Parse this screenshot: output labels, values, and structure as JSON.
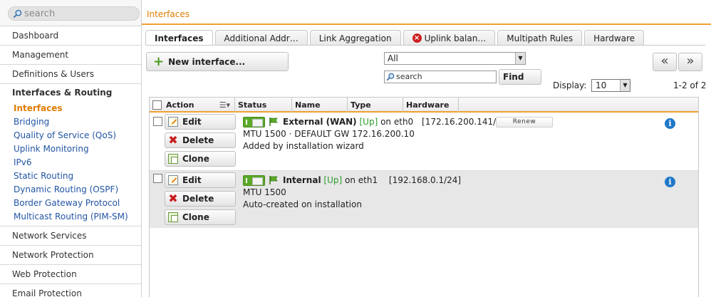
{
  "sidebar": {
    "search_placeholder": "search",
    "categories_top": [
      "Dashboard",
      "Management",
      "Definitions & Users"
    ],
    "open_category": "Interfaces & Routing",
    "sub_items": [
      "Interfaces",
      "Bridging",
      "Quality of Service (QoS)",
      "Uplink Monitoring",
      "IPv6",
      "Static Routing",
      "Dynamic Routing (OSPF)",
      "Border Gateway Protocol",
      "Multicast Routing (PIM-SM)"
    ],
    "active_sub": "Interfaces",
    "categories_bottom": [
      "Network Services",
      "Network Protection",
      "Web Protection",
      "Email Protection"
    ]
  },
  "header": {
    "title": "Interfaces"
  },
  "tabs": [
    {
      "label": "Interfaces",
      "active": true
    },
    {
      "label": "Additional Addr…"
    },
    {
      "label": "Link Aggregation"
    },
    {
      "label": "Uplink balan…",
      "icon": "error-icon"
    },
    {
      "label": "Multipath Rules"
    },
    {
      "label": "Hardware"
    }
  ],
  "toolbar": {
    "new_label": "New interface...",
    "filter_value": "All",
    "search_value": "search",
    "find_label": "Find",
    "prev_label": "«",
    "next_label": "»",
    "display_label": "Display:",
    "display_value": "10",
    "count": "1-2 of 2"
  },
  "table": {
    "columns": [
      "Action",
      "Status",
      "Name",
      "Type",
      "Hardware"
    ],
    "actions": {
      "edit": "Edit",
      "delete": "Delete",
      "clone": "Clone"
    },
    "rows": [
      {
        "name": "External (WAN)",
        "state": "[Up]",
        "on": "on eth0",
        "address": "[172.16.200.141/24]",
        "detail": "MTU 1500 · DEFAULT GW 172.16.200.10",
        "comment": "Added by installation wizard",
        "renew": "Renew",
        "enabled": true
      },
      {
        "name": "Internal",
        "state": "[Up]",
        "on": "on eth1",
        "address": "[192.168.0.1/24]",
        "detail": "MTU 1500",
        "comment": "Auto-created on installation",
        "enabled": true
      }
    ]
  },
  "colors": {
    "accent": "#e07b00",
    "link": "#2255a4",
    "up": "#2a9a2a",
    "toggle": "#5aaa28",
    "info": "#1e78c8"
  }
}
